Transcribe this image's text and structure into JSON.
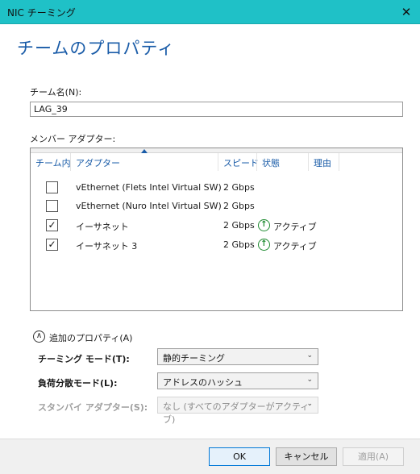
{
  "window": {
    "title": "NIC チーミング",
    "close_glyph": "✕"
  },
  "heading": "チームのプロパティ",
  "team_name": {
    "label": "チーム名(N):",
    "value": "LAG_39"
  },
  "members": {
    "label": "メンバー アダプター:",
    "columns": [
      "チーム内",
      "アダプター",
      "スピード",
      "状態",
      "理由"
    ],
    "rows": [
      {
        "checked": false,
        "check_glyph": "",
        "adapter": "vEthernet (Flets Intel Virtual SW)",
        "speed": "2 Gbps",
        "status": "",
        "status_icon": ""
      },
      {
        "checked": false,
        "check_glyph": "",
        "adapter": "vEthernet (Nuro Intel Virtual SW)",
        "speed": "2 Gbps",
        "status": "",
        "status_icon": ""
      },
      {
        "checked": true,
        "check_glyph": "✓",
        "adapter": "イーサネット",
        "speed": "2 Gbps",
        "status": "アクティブ",
        "status_icon": "↑"
      },
      {
        "checked": true,
        "check_glyph": "✓",
        "adapter": "イーサネット 3",
        "speed": "2 Gbps",
        "status": "アクティブ",
        "status_icon": "↑"
      }
    ]
  },
  "additional": {
    "label": "追加のプロパティ(A)",
    "chevron": "∧"
  },
  "fields": [
    {
      "label": "チーミング モード(T):",
      "value": "静的チーミング",
      "chevron": "⌄"
    },
    {
      "label": "負荷分散モード(L):",
      "value": "アドレスのハッシュ",
      "chevron": "⌄"
    },
    {
      "label": "スタンバイ アダプター(S):",
      "value": "なし (すべてのアダプターがアクティブ)",
      "chevron": "⌄"
    }
  ],
  "buttons": {
    "ok": "OK",
    "cancel": "キャンセル",
    "apply": "適用(A)"
  },
  "colors": {
    "titlebar": "#1fc1c7",
    "accent": "#1a5ca8",
    "active_green": "#1d8a2f"
  }
}
